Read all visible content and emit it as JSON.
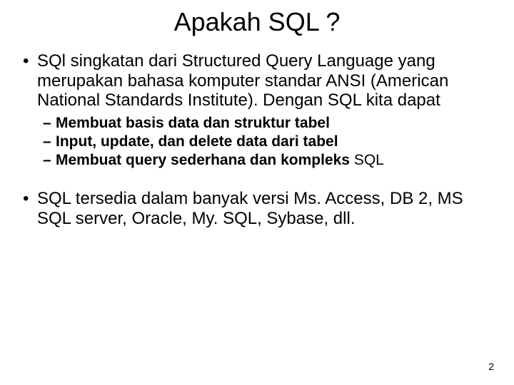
{
  "title": "Apakah SQL ?",
  "bullets": {
    "b1": "SQl singkatan dari Structured Query Language yang merupakan bahasa komputer standar ANSI (American National Standards Institute). Dengan SQL kita dapat",
    "sub1": "Membuat basis data dan struktur tabel",
    "sub2": "Input, update, dan delete data dari tabel",
    "sub3": "Membuat query sederhana dan kompleks",
    "sub3_tail": "SQL",
    "b2": "SQL tersedia dalam banyak versi Ms. Access, DB 2,  MS SQL server, Oracle, My. SQL, Sybase, dll."
  },
  "page_number": "2"
}
